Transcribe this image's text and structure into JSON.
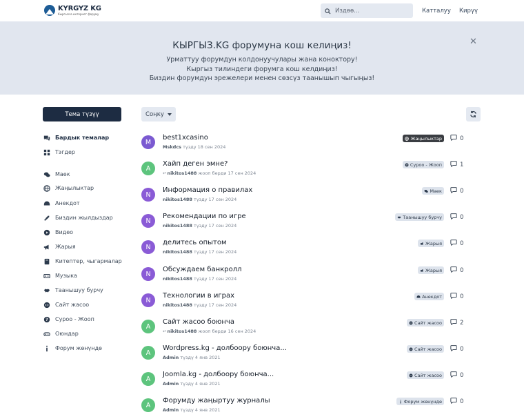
{
  "header": {
    "logo_title": "KYRGYZ KG",
    "logo_subtitle": "Кыргызча интернет форуму",
    "search_placeholder": "Издөө...",
    "register_label": "Катталуу",
    "login_label": "Кирүү"
  },
  "hero": {
    "title": "КЫРГЫЗ.KG форумуна кош келиңиз!",
    "lines": [
      "Урматтуу форумдун колдонуучулары жана коноктору!",
      "Кыргыз тилиндеги форумга кош келдиңиз!",
      "Биздин форумдун эрежелери менен сөзсүз таанышып чыгыңыз!"
    ],
    "close_icon": "close-icon"
  },
  "sidebar": {
    "new_topic_label": "Тема түзүү",
    "items": [
      {
        "label": "Бардык темалар",
        "icon": "discussions-icon",
        "active": true
      },
      {
        "label": "Тэгдер",
        "icon": "tags-grid-icon"
      },
      {
        "label": "Маек",
        "icon": "chat-icon"
      },
      {
        "label": "Жаңылыктар",
        "icon": "globe-icon"
      },
      {
        "label": "Анекдот",
        "icon": "smile-icon"
      },
      {
        "label": "Биздин жылдыздар",
        "icon": "rocket-icon"
      },
      {
        "label": "Видео",
        "icon": "play-icon"
      },
      {
        "label": "Жарыя",
        "icon": "bullhorn-icon"
      },
      {
        "label": "Китептер, чыгармалар",
        "icon": "book-icon"
      },
      {
        "label": "Музыка",
        "icon": "music-icon"
      },
      {
        "label": "Таанышуу бурчу",
        "icon": "handshake-icon"
      },
      {
        "label": "Сайт жасоо",
        "icon": "code-icon"
      },
      {
        "label": "Суроо - Жооп",
        "icon": "question-icon"
      },
      {
        "label": "Оюндар",
        "icon": "gamepad-icon"
      },
      {
        "label": "Форум жөнүндө",
        "icon": "info-icon"
      }
    ]
  },
  "toolbar": {
    "sort_label": "Соңку",
    "refresh_icon": "refresh-icon"
  },
  "topics": [
    {
      "avatar": "M",
      "color": "#7b5ad1",
      "title": "best1xcasino",
      "author": "Mskdcs",
      "meta": "түздү 18 сен 2024",
      "reply": false,
      "tag": "Жаңылыктар",
      "tag_icon": "globe-icon",
      "tag_dark": true,
      "count": "0"
    },
    {
      "avatar": "A",
      "color": "#5dc47d",
      "title": "Хайп деген эмне?",
      "author": "nikitos1488",
      "meta": "жооп берди 17 сен 2024",
      "reply": true,
      "tag": "Суроо - Жооп",
      "tag_icon": "question-icon",
      "count": "1"
    },
    {
      "avatar": "N",
      "color": "#8a5bd6",
      "title": "Информация о правилах",
      "author": "nikitos1488",
      "meta": "түздү 17 сен 2024",
      "reply": false,
      "tag": "Маек",
      "tag_icon": "chat-icon",
      "count": "0"
    },
    {
      "avatar": "N",
      "color": "#8a5bd6",
      "title": "Рекомендации по игре",
      "author": "nikitos1488",
      "meta": "түздү 17 сен 2024",
      "reply": false,
      "tag": "Таанышуу бурчу",
      "tag_icon": "handshake-icon",
      "count": "0"
    },
    {
      "avatar": "N",
      "color": "#8a5bd6",
      "title": "делитесь опытом",
      "author": "nikitos1488",
      "meta": "түздү 17 сен 2024",
      "reply": false,
      "tag": "Жарыя",
      "tag_icon": "bullhorn-icon",
      "count": "0"
    },
    {
      "avatar": "N",
      "color": "#8a5bd6",
      "title": "Обсуждаем банкролл",
      "author": "nikitos1488",
      "meta": "түздү 17 сен 2024",
      "reply": false,
      "tag": "Жарыя",
      "tag_icon": "bullhorn-icon",
      "count": "0"
    },
    {
      "avatar": "N",
      "color": "#8a5bd6",
      "title": "Технологии в играх",
      "author": "nikitos1488",
      "meta": "түздү 17 сен 2024",
      "reply": false,
      "tag": "Анекдот",
      "tag_icon": "smile-icon",
      "count": "0"
    },
    {
      "avatar": "A",
      "color": "#5dc47d",
      "title": "Сайт жасоо боюнча",
      "author": "nikitos1488",
      "meta": "жооп берди 16 сен 2024",
      "reply": true,
      "tag": "Сайт жасоо",
      "tag_icon": "code-icon",
      "count": "2"
    },
    {
      "avatar": "A",
      "color": "#5dc47d",
      "title": "Wordpress.kg - долбоору боюнча...",
      "author": "Admin",
      "meta": "түздү 4 янв 2021",
      "reply": false,
      "tag": "Сайт жасоо",
      "tag_icon": "code-icon",
      "count": "0"
    },
    {
      "avatar": "A",
      "color": "#5dc47d",
      "title": "Joomla.kg - долбоору боюнча...",
      "author": "Admin",
      "meta": "түздү 4 янв 2021",
      "reply": false,
      "tag": "Сайт жасоо",
      "tag_icon": "code-icon",
      "count": "0"
    },
    {
      "avatar": "A",
      "color": "#5dc47d",
      "title": "Форумду жаңыртуу журналы",
      "author": "Admin",
      "meta": "түздү 4 янв 2021",
      "reply": false,
      "tag": "Форум жөнүндө",
      "tag_icon": "info-icon",
      "count": "0"
    }
  ]
}
